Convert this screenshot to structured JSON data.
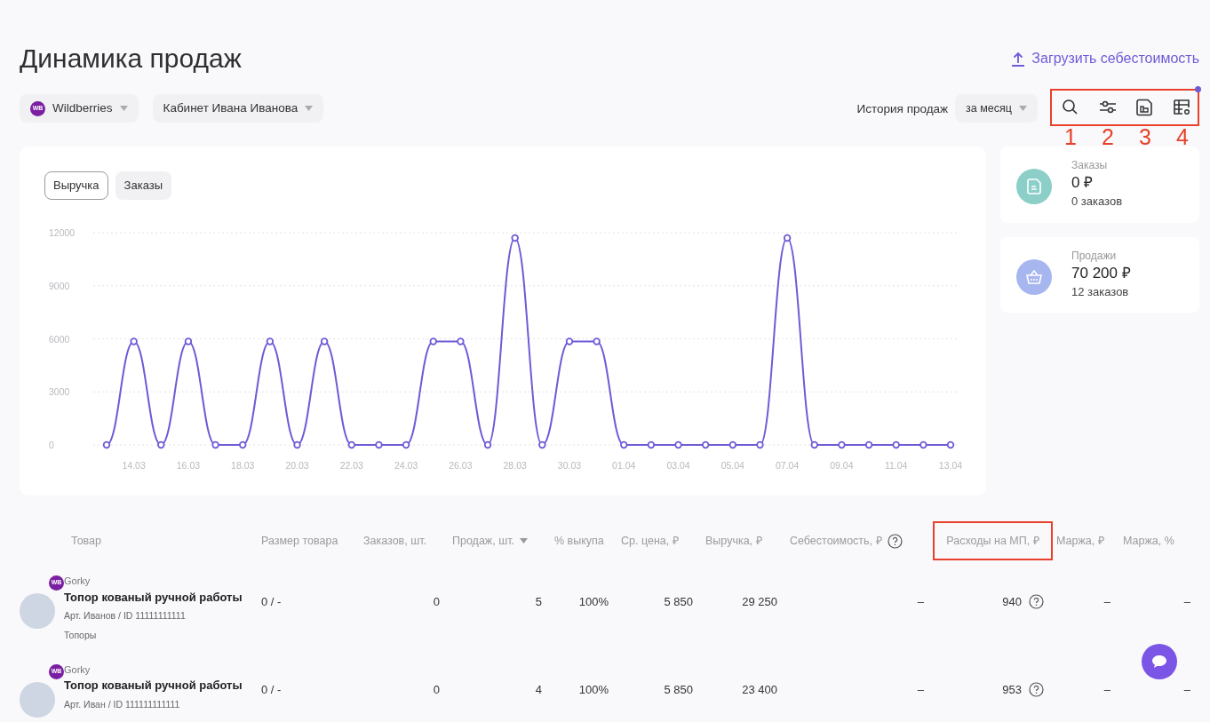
{
  "page": {
    "title": "Динамика продаж",
    "upload_link": "Загрузить себестоимость"
  },
  "filters": [
    {
      "kind": "marketplace",
      "label": "Wildberries",
      "badge": "WB"
    },
    {
      "kind": "account",
      "label": "Кабинет Ивана Иванова"
    }
  ],
  "history": {
    "label": "История продаж",
    "period": "за месяц"
  },
  "toolbar": {
    "highlighted": true,
    "icons": [
      {
        "kind": "search",
        "callout": "1",
        "dot": false
      },
      {
        "kind": "filter",
        "callout": "2",
        "dot": false
      },
      {
        "kind": "report",
        "callout": "3",
        "dot": false
      },
      {
        "kind": "table-settings",
        "callout": "4",
        "dot": true
      }
    ]
  },
  "chart_tabs": [
    {
      "label": "Выручка",
      "selected": true
    },
    {
      "label": "Заказы",
      "selected": false
    }
  ],
  "chart_data": {
    "type": "line",
    "grid": true,
    "categories": [
      null,
      "14.03",
      null,
      "16.03",
      null,
      "18.03",
      null,
      "20.03",
      null,
      "22.03",
      null,
      "24.03",
      null,
      "26.03",
      null,
      "28.03",
      null,
      "30.03",
      null,
      "01.04",
      null,
      "03.04",
      null,
      "05.04",
      null,
      "07.04",
      null,
      "09.04",
      null,
      "11.04",
      null,
      "13.04"
    ],
    "series": [
      {
        "color": "#6e5bd6",
        "marker": "circle",
        "values": [
          0,
          5850,
          0,
          5850,
          0,
          0,
          5850,
          0,
          5850,
          0,
          0,
          0,
          5850,
          5850,
          0,
          11700,
          0,
          5850,
          5850,
          0,
          0,
          0,
          0,
          0,
          0,
          11700,
          0,
          0,
          0,
          0,
          0,
          0
        ]
      }
    ],
    "ylim": [
      0,
      12000
    ],
    "yticks": [
      0,
      3000,
      6000,
      9000,
      12000
    ]
  },
  "stats": [
    {
      "kind": "orders",
      "title": "Заказы",
      "value": "0 ₽",
      "sub": "0 заказов",
      "color": "#8ccfc8"
    },
    {
      "kind": "sales",
      "title": "Продажи",
      "value": "70 200 ₽",
      "sub": "12 заказов",
      "color": "#a7b6ef"
    }
  ],
  "table": {
    "columns": [
      {
        "label": "Товар",
        "sorted": false,
        "help": false,
        "highlighted": false
      },
      {
        "label": "Размер товара",
        "sorted": false,
        "help": false,
        "highlighted": false
      },
      {
        "label": "Заказов, шт.",
        "sorted": false,
        "help": false,
        "highlighted": false
      },
      {
        "label": "Продаж, шт.",
        "sorted": true,
        "help": false,
        "highlighted": false
      },
      {
        "label": "% выкупа",
        "sorted": false,
        "help": false,
        "highlighted": false
      },
      {
        "label": "Ср. цена, ₽",
        "sorted": false,
        "help": false,
        "highlighted": false
      },
      {
        "label": "Выручка, ₽",
        "sorted": false,
        "help": false,
        "highlighted": false
      },
      {
        "label": "Себестоимость, ₽",
        "sorted": false,
        "help": true,
        "highlighted": false
      },
      {
        "label": "Расходы на МП, ₽",
        "sorted": false,
        "help": false,
        "highlighted": true
      },
      {
        "label": "Маржа, ₽",
        "sorted": false,
        "help": false,
        "highlighted": false
      },
      {
        "label": "Маржа, %",
        "sorted": false,
        "help": false,
        "highlighted": false
      }
    ],
    "rows": [
      {
        "cells": [
          {
            "kind": "product",
            "badge": "WB",
            "brand": "Gorky",
            "name": "Топор кованый ручной работы",
            "article": "Арт. Иванов / ID 11111111111",
            "category": "Топоры"
          },
          {
            "kind": "value",
            "text": "0 / -",
            "help": false
          },
          {
            "text": "0",
            "help": false
          },
          {
            "text": "5",
            "help": false
          },
          {
            "text": "100%",
            "help": false
          },
          {
            "text": "5 850",
            "help": false
          },
          {
            "text": "29 250",
            "help": false
          },
          {
            "text": "–",
            "help": false
          },
          {
            "text": "940",
            "help": true
          },
          {
            "text": "–",
            "help": false
          },
          {
            "text": "–",
            "help": false
          }
        ]
      },
      {
        "cells": [
          {
            "kind": "product",
            "badge": "WB",
            "brand": "Gorky",
            "name": "Топор кованый ручной работы",
            "article": "Арт. Иван / ID 111111111111"
          },
          {
            "kind": "value",
            "text": "0 / -",
            "help": false
          },
          {
            "text": "0",
            "help": false
          },
          {
            "text": "4",
            "help": false
          },
          {
            "text": "100%",
            "help": false
          },
          {
            "text": "5 850",
            "help": false
          },
          {
            "text": "23 400",
            "help": false
          },
          {
            "text": "–",
            "help": false
          },
          {
            "text": "953",
            "help": true
          },
          {
            "text": "–",
            "help": false
          },
          {
            "text": "–",
            "help": false
          }
        ]
      }
    ]
  }
}
